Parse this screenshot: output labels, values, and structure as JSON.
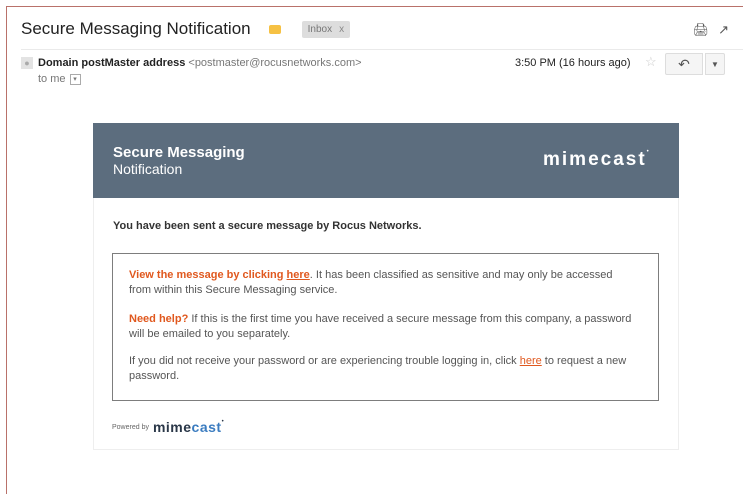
{
  "header": {
    "subject": "Secure Messaging Notification",
    "label_chip": "Inbox",
    "label_chip_close": "x"
  },
  "message": {
    "sender_name": "Domain postMaster address",
    "sender_email": "<postmaster@rocusnetworks.com>",
    "recipient": "to me",
    "time": "3:50 PM (16 hours ago)"
  },
  "body": {
    "banner_title": "Secure Messaging",
    "banner_subtitle": "Notification",
    "brand_logo": "mimecast",
    "intro": "You have been sent a secure message by Rocus Networks.",
    "p1_lead": "View the message by clicking ",
    "p1_link": "here",
    "p1_rest": ". It has been classified as sensitive and may only be accessed from within this Secure Messaging service.",
    "p2_lead": "Need help?",
    "p2_rest": " If this is the first time you have received a secure message from this company, a password will be emailed to you separately.",
    "p3_lead": "If you did not receive your password or are experiencing trouble logging in, click ",
    "p3_link": "here",
    "p3_rest": " to request a new password.",
    "powered_label": "Powered by",
    "powered_logo_a": "mime",
    "powered_logo_b": "cast"
  },
  "colors": {
    "banner": "#5c6d7e",
    "accent_orange": "#e0581e",
    "label_yellow": "#f6c143"
  },
  "icons": [
    "print-icon",
    "new-window-icon",
    "star-icon",
    "reply-icon",
    "more-dropdown-icon",
    "avatar-icon"
  ]
}
